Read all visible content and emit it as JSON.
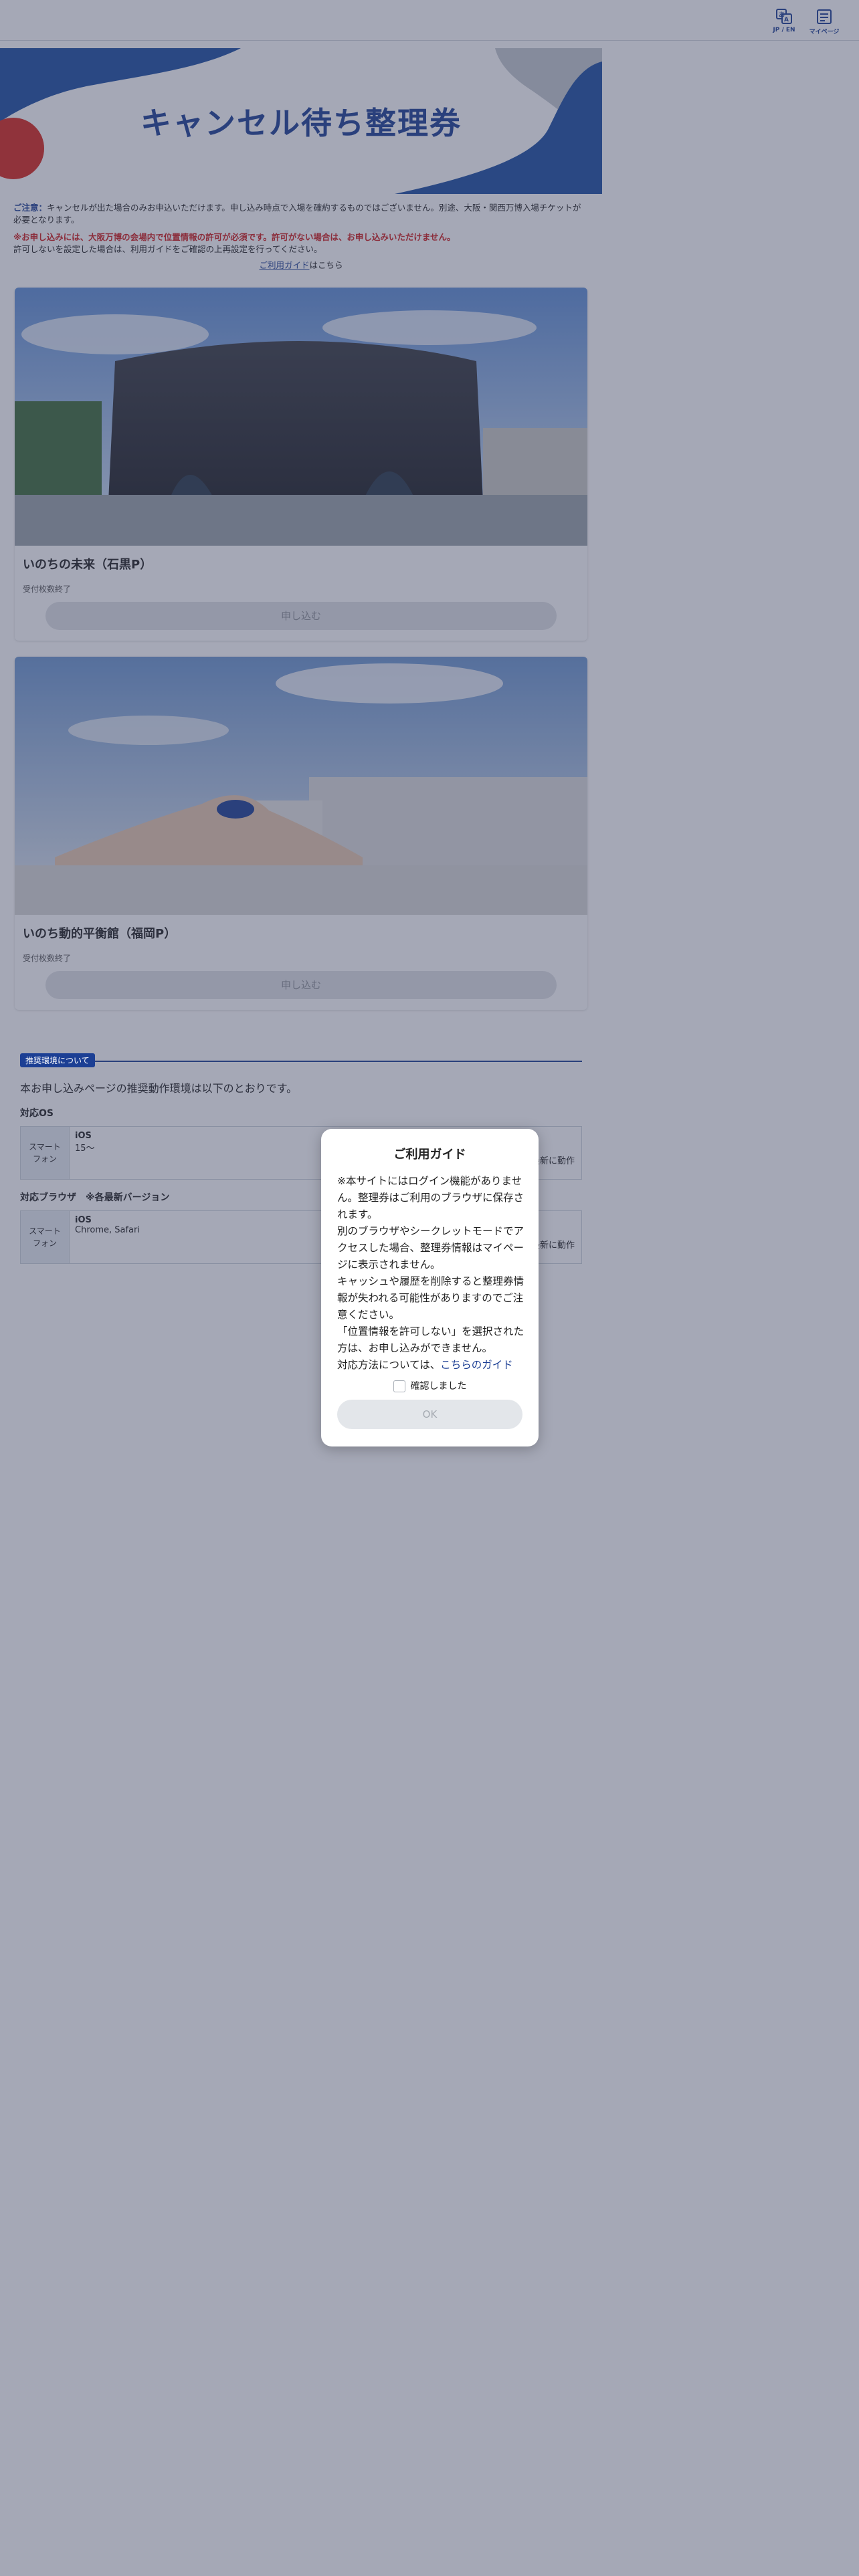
{
  "header": {
    "lang_label": "JP / EN",
    "mypage_label": "マイページ"
  },
  "hero": {
    "title": "キャンセル待ち整理券"
  },
  "notice": {
    "lead_label": "ご注意：",
    "lead_text": "キャンセルが出た場合のみお申込いただけます。申し込み時点で入場を確約するものではございません。別途、大阪・関西万博入場チケットが必要となります。",
    "warning": "※お申し込みには、大阪万博の会場内で位置情報の許可が必須です。許可がない場合は、お申し込みいただけません。",
    "permission": "許可しないを設定した場合は、利用ガイドをご確認の上再設定を行ってください。",
    "guide_link": "ご利用ガイド",
    "guide_suffix": "はこちら"
  },
  "cards": [
    {
      "title": "いのちの未来（石黒P）",
      "status": "受付枚数終了",
      "button": "申し込む"
    },
    {
      "title": "いのち動的平衡館（福岡P）",
      "status": "受付枚数終了",
      "button": "申し込む"
    }
  ],
  "env": {
    "badge": "推奨環境について",
    "desc": "本お申し込みページの推奨動作環境は以下のとおりです。",
    "os_heading": "対応OS",
    "os_row": {
      "device": "スマートフォン",
      "name": "iOS",
      "version": "15～",
      "note": "最新に動作"
    },
    "browser_heading": "対応ブラウザ　※各最新バージョン",
    "browser_row": {
      "device": "スマートフォン",
      "name": "iOS",
      "browsers": "Chrome, Safari",
      "note": "最新に動作"
    }
  },
  "modal": {
    "title": "ご利用ガイド",
    "p1": "※本サイトにはログイン機能がありません。整理券はご利用のブラウザに保存されます。",
    "p2": "別のブラウザやシークレットモードでアクセスした場合、整理券情報はマイページに表示されません。",
    "p3": "キャッシュや履歴を削除すると整理券情報が失われる可能性がありますのでご注意ください。",
    "p4": "「位置情報を許可しない」を選択された方は、お申し込みができません。",
    "p5_prefix": "対応方法については、",
    "p5_link": "こちらのガイド",
    "checkbox_label": "確認しました",
    "ok_label": "OK"
  }
}
